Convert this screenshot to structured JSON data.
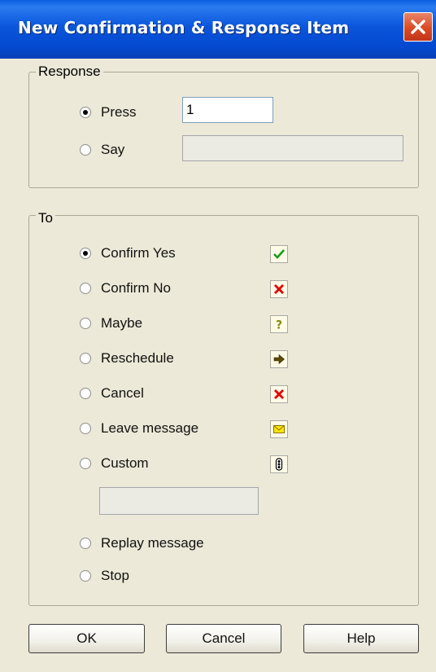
{
  "window": {
    "title": "New Confirmation & Response Item"
  },
  "response": {
    "label": "Response",
    "options": [
      {
        "label": "Press",
        "checked": true,
        "value": "1"
      },
      {
        "label": "Say",
        "checked": false,
        "value": ""
      }
    ]
  },
  "to": {
    "label": "To",
    "options": [
      {
        "label": "Confirm Yes",
        "checked": true,
        "icon": "checkmark-icon"
      },
      {
        "label": "Confirm No",
        "checked": false,
        "icon": "red-x-icon"
      },
      {
        "label": "Maybe",
        "checked": false,
        "icon": "question-mark-icon"
      },
      {
        "label": "Reschedule",
        "checked": false,
        "icon": "right-arrow-icon"
      },
      {
        "label": "Cancel",
        "checked": false,
        "icon": "red-x-icon"
      },
      {
        "label": "Leave message",
        "checked": false,
        "icon": "envelope-icon"
      },
      {
        "label": "Custom",
        "checked": false,
        "icon": "custom-sequence-icon"
      },
      {
        "label": "Replay message",
        "checked": false
      },
      {
        "label": "Stop",
        "checked": false
      }
    ],
    "custom_value": ""
  },
  "buttons": {
    "ok": "OK",
    "cancel": "Cancel",
    "help": "Help"
  },
  "colors": {
    "titlebar": "#0349cf",
    "dialog_bg": "#ece9d8",
    "close": "#d94b24"
  }
}
